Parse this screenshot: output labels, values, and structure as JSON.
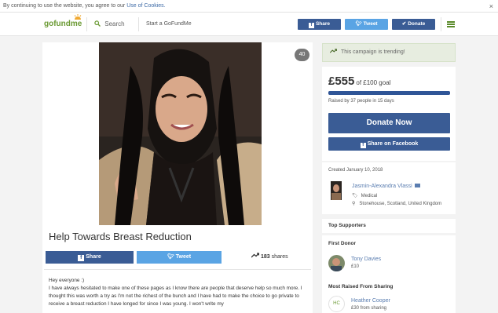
{
  "cookie": {
    "text": "By continuing to use the website, you agree to our",
    "link": "Use of Cookies.",
    "close": "×"
  },
  "header": {
    "logo": "gofundme",
    "search_label": "Search",
    "start_label": "Start a GoFundMe",
    "share_label": "Share",
    "tweet_label": "Tweet",
    "donate_label": "Donate"
  },
  "campaign": {
    "hearts": "40",
    "title": "Help Towards Breast Reduction",
    "share_label": "Share",
    "tweet_label": "Tweet",
    "share_count": "183",
    "shares_word": "shares",
    "story": [
      "Hey everyone :)",
      "I have always hesitated to make one of these pages as I know there are people that deserve help so much more. I thought this was worth a try as I'm not the richest of the bunch and I have had to make the choice to go private to receive a breast reduction I have longed for since I was young. I won't write my"
    ]
  },
  "sidebar": {
    "trending": "This campaign is trending!",
    "amount": "£555",
    "goal": "of £100 goal",
    "progress_pct": 100,
    "raised_text": "Raised by 37 people in 15 days",
    "donate_now": "Donate Now",
    "share_facebook": "Share on Facebook",
    "created": "Created January 10, 2018",
    "organizer_name": "Jasmin-Alexandra Vlassi",
    "organizer_category": "Medical",
    "organizer_location": "Stonehouse, Scotland, United Kingdom",
    "top_supporters": "Top Supporters",
    "first_donor_label": "First Donor",
    "first_donor_name": "Tony Davies",
    "first_donor_amount": "£10",
    "most_raised_label": "Most Raised From Sharing",
    "sharer_initials": "HC",
    "sharer_name": "Heather Cooper",
    "sharer_amount": "£30 from sharing"
  },
  "colors": {
    "brand_green": "#6b9a34",
    "facebook_blue": "#3a5c95",
    "twitter_blue": "#5aa4e4",
    "progress": "#2f5597"
  }
}
